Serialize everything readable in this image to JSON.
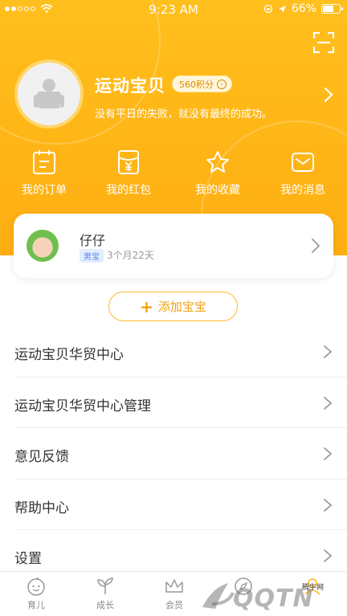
{
  "status_bar": {
    "time": "9:23 AM",
    "battery": "66%",
    "battery_level": 0.66
  },
  "header": {
    "user_name": "运动宝贝",
    "points": "560积分",
    "motto": "没有平日的失败，就没有最终的成功。",
    "scan_icon": "scan-icon",
    "colors": {
      "accent": "#ffb514",
      "badge_text": "#d98b00"
    }
  },
  "quick_nav": [
    {
      "label": "我的订单",
      "icon": "order-icon"
    },
    {
      "label": "我的红包",
      "icon": "red-packet-icon"
    },
    {
      "label": "我的收藏",
      "icon": "star-icon"
    },
    {
      "label": "我的消息",
      "icon": "message-icon"
    }
  ],
  "baby": {
    "name": "仔仔",
    "gender": "男宝",
    "age": "3个月22天"
  },
  "add_baby": {
    "label": "添加宝宝"
  },
  "menu": [
    {
      "label": "运动宝贝华贸中心"
    },
    {
      "label": "运动宝贝华贸中心管理"
    },
    {
      "label": "意见反馈"
    },
    {
      "label": "帮助中心"
    },
    {
      "label": "设置"
    }
  ],
  "tabs": [
    {
      "label": "育儿",
      "icon": "baby-face-icon"
    },
    {
      "label": "成长",
      "icon": "sprout-icon"
    },
    {
      "label": "会员",
      "icon": "crown-icon"
    },
    {
      "label": "",
      "icon": "compass-icon"
    },
    {
      "label": "",
      "icon": "profile-icon"
    }
  ],
  "watermark": {
    "text": "QQTN",
    "sub": "腾牛网"
  }
}
